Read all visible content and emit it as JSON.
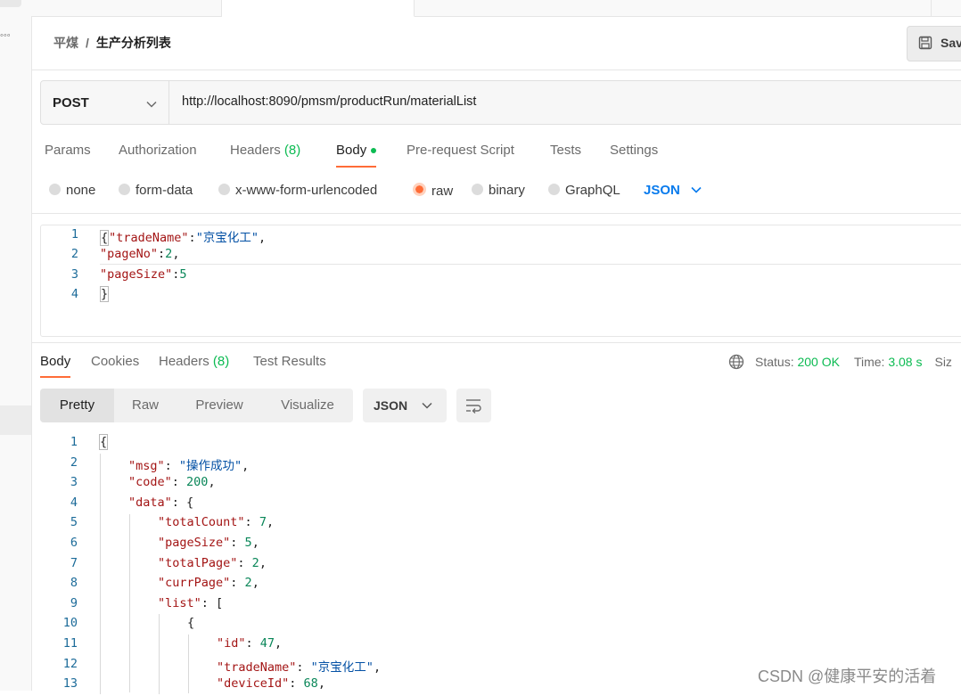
{
  "breadcrumb": {
    "parent": "平煤",
    "separator": "/",
    "current": "生产分析列表"
  },
  "save_button": {
    "label": "Sav"
  },
  "request": {
    "method": "POST",
    "url": "http://localhost:8090/pmsm/productRun/materialList"
  },
  "request_tabs": [
    {
      "label": "Params"
    },
    {
      "label": "Authorization"
    },
    {
      "label": "Headers",
      "count": "(8)"
    },
    {
      "label": "Body",
      "active": true
    },
    {
      "label": "Pre-request Script"
    },
    {
      "label": "Tests"
    },
    {
      "label": "Settings"
    }
  ],
  "body_types": [
    "none",
    "form-data",
    "x-www-form-urlencoded",
    "raw",
    "binary",
    "GraphQL"
  ],
  "body_type_selected": "raw",
  "body_format": "JSON",
  "request_body": {
    "line_numbers": [
      "1",
      "2",
      "3",
      "4"
    ],
    "lines": [
      {
        "p1": "{",
        "key": "\"tradeName\"",
        "p2": ":",
        "val": "\"京宝化工\"",
        "p3": ","
      },
      {
        "p1": "",
        "key": "\"pageNo\"",
        "p2": ":",
        "val": "2",
        "p3": ","
      },
      {
        "p1": "",
        "key": "\"pageSize\"",
        "p2": ":",
        "val": "5",
        "p3": ""
      },
      {
        "p1": "}",
        "key": "",
        "p2": "",
        "val": "",
        "p3": ""
      }
    ]
  },
  "response_tabs": [
    {
      "label": "Body",
      "active": true
    },
    {
      "label": "Cookies"
    },
    {
      "label": "Headers",
      "count": "(8)"
    },
    {
      "label": "Test Results"
    }
  ],
  "response_status": {
    "status_label": "Status:",
    "status_value": "200 OK",
    "time_label": "Time:",
    "time_value": "3.08 s",
    "size_label": "Siz"
  },
  "view_modes": [
    "Pretty",
    "Raw",
    "Preview",
    "Visualize"
  ],
  "view_mode_selected": "Pretty",
  "response_format": "JSON",
  "response_body": {
    "line_numbers": [
      "1",
      "2",
      "3",
      "4",
      "5",
      "6",
      "7",
      "8",
      "9",
      "10",
      "11",
      "12",
      "13"
    ],
    "lines": [
      {
        "key": "",
        "val": "",
        "open": "{"
      },
      {
        "key": "\"msg\"",
        "val": "\"操作成功\"",
        "open": ","
      },
      {
        "key": "\"code\"",
        "val": "200",
        "open": ","
      },
      {
        "key": "\"data\"",
        "val": "",
        "open": "{"
      },
      {
        "key": "\"totalCount\"",
        "val": "7",
        "open": ","
      },
      {
        "key": "\"pageSize\"",
        "val": "5",
        "open": ","
      },
      {
        "key": "\"totalPage\"",
        "val": "2",
        "open": ","
      },
      {
        "key": "\"currPage\"",
        "val": "2",
        "open": ","
      },
      {
        "key": "\"list\"",
        "val": "",
        "open": "["
      },
      {
        "key": "",
        "val": "",
        "open": "{"
      },
      {
        "key": "\"id\"",
        "val": "47",
        "open": ","
      },
      {
        "key": "\"tradeName\"",
        "val": "\"京宝化工\"",
        "open": ","
      },
      {
        "key": "\"deviceId\"",
        "val": "68",
        "open": ","
      }
    ]
  },
  "watermark": "CSDN @健康平安的活着",
  "colors": {
    "accent": "#ff6c37",
    "success": "#0cbb52",
    "link": "#097bed"
  }
}
